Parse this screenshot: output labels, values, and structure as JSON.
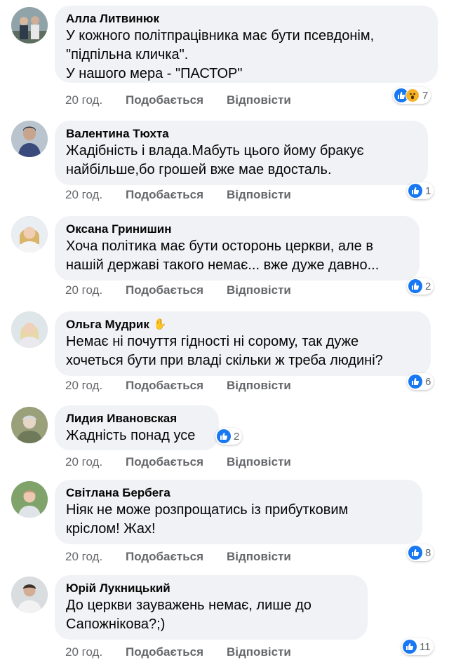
{
  "actions": {
    "like": "Подобається",
    "reply": "Відповісти"
  },
  "colors": {
    "accent": "#1877f2",
    "bubble": "#f0f2f5",
    "meta": "#65676b"
  },
  "comments": [
    {
      "author": "Алла Литвинюк",
      "text": "У кожного політпрацівника  має бути псевдонім,\n\"підпільна кличка\".\nУ нашого мера - \"ПАСТОР\"",
      "time": "20 год.",
      "reaction_count": "7",
      "reactions": [
        "like-icon",
        "wow-icon"
      ]
    },
    {
      "author": "Валентина Тюхта",
      "text": "Жадібність і влада.Мабуть цього йому бракує\nнайбільше,бо грошей вже мае вдосталь.",
      "time": "20 год.",
      "reaction_count": "1",
      "reactions": [
        "like-icon"
      ]
    },
    {
      "author": "Оксана Гринишин",
      "text": "Хоча політика має бути осторонь церкви, але в\nнашій державі такого немає... вже дуже давно...",
      "time": "20 год.",
      "reaction_count": "2",
      "reactions": [
        "like-icon"
      ]
    },
    {
      "author": "Ольга Мудрик",
      "badge_icon": "waving-hand-icon",
      "text": "Немає ні почуття гідності ні сорому, так дуже\nхочеться бути при владі скільки ж треба людині?",
      "time": "20 год.",
      "reaction_count": "6",
      "reactions": [
        "like-icon"
      ]
    },
    {
      "author": "Лидия Ивановская",
      "text": "Жадність понад усе",
      "time": "20 год.",
      "reaction_count": "2",
      "reactions": [
        "like-icon"
      ]
    },
    {
      "author": "Світлана Бербега",
      "text": "Ніяк не може розпрощатись із прибутковим\nкріслом! Жах!",
      "time": "20 год.",
      "reaction_count": "8",
      "reactions": [
        "like-icon"
      ]
    },
    {
      "author": "Юрій Лукницький",
      "text": "До церкви зауважень немає, лише до\nСапожнікова?;)",
      "time": "20 год.",
      "reaction_count": "11",
      "reactions": [
        "like-icon"
      ]
    }
  ]
}
